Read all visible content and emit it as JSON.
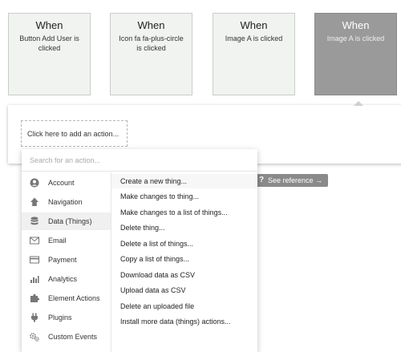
{
  "events": [
    {
      "title": "When",
      "desc": "Button Add User is clicked"
    },
    {
      "title": "When",
      "desc": "Icon fa fa-plus-circle is clicked"
    },
    {
      "title": "When",
      "desc": "Image A is clicked"
    },
    {
      "title": "When",
      "desc": "Image A is clicked"
    }
  ],
  "add_action_label": "Click here to add an action...",
  "search_placeholder": "Search for an action...",
  "categories": [
    {
      "label": "Account",
      "icon": "account-icon"
    },
    {
      "label": "Navigation",
      "icon": "navigation-icon"
    },
    {
      "label": "Data (Things)",
      "icon": "database-icon"
    },
    {
      "label": "Email",
      "icon": "email-icon"
    },
    {
      "label": "Payment",
      "icon": "credit-card-icon"
    },
    {
      "label": "Analytics",
      "icon": "bar-chart-icon"
    },
    {
      "label": "Element Actions",
      "icon": "puzzle-icon"
    },
    {
      "label": "Plugins",
      "icon": "plug-icon"
    },
    {
      "label": "Custom Events",
      "icon": "gears-icon"
    }
  ],
  "active_category": "Data (Things)",
  "actions": [
    "Create a new thing...",
    "Make changes to thing...",
    "Make changes to a list of things...",
    "Delete thing...",
    "Delete a list of things...",
    "Copy a list of things...",
    "Download data as CSV",
    "Upload data as CSV",
    "Delete an uploaded file",
    "Install more data (things) actions..."
  ],
  "see_reference": {
    "icon": "?",
    "label": "See reference →"
  },
  "colors": {
    "selected_card": "#9a9a9a",
    "card": "#f1f3f1",
    "reference_badge": "#8a8a8a"
  }
}
